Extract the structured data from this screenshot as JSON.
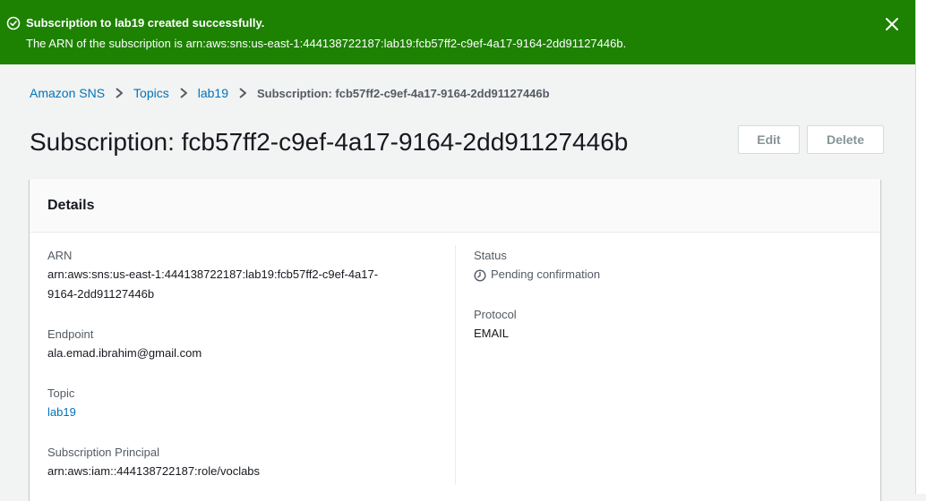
{
  "flash": {
    "title": "Subscription to lab19 created successfully.",
    "message": "The ARN of the subscription is arn:aws:sns:us-east-1:444138722187:lab19:fcb57ff2-c9ef-4a17-9164-2dd91127446b.",
    "icon": "check-circle-icon",
    "close_icon": "close-icon",
    "color": "#1d8102"
  },
  "breadcrumb": {
    "items": [
      "Amazon SNS",
      "Topics",
      "lab19"
    ],
    "current": "Subscription: fcb57ff2-c9ef-4a17-9164-2dd91127446b"
  },
  "page": {
    "title": "Subscription: fcb57ff2-c9ef-4a17-9164-2dd91127446b",
    "edit_label": "Edit",
    "delete_label": "Delete"
  },
  "details": {
    "title": "Details",
    "arn_label": "ARN",
    "arn_line1": "arn:aws:sns:us-east-1:444138722187:lab19:fcb57ff2-c9ef-4a17-",
    "arn_line2": "9164-2dd91127446b",
    "endpoint_label": "Endpoint",
    "endpoint_value": "ala.emad.ibrahim@gmail.com",
    "topic_label": "Topic",
    "topic_value": "lab19",
    "principal_label": "Subscription Principal",
    "principal_value": "arn:aws:iam::444138722187:role/voclabs",
    "status_label": "Status",
    "status_value": "Pending confirmation",
    "status_icon": "clock-icon",
    "protocol_label": "Protocol",
    "protocol_value": "EMAIL"
  },
  "colors": {
    "success": "#1d8102",
    "link": "#0073bb",
    "background": "#f2f3f3"
  }
}
